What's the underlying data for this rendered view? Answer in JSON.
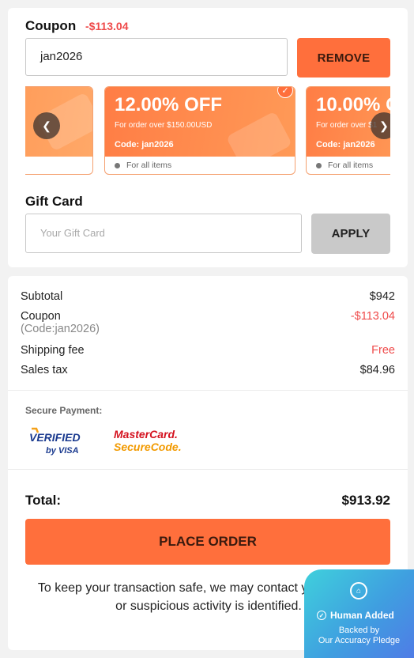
{
  "coupon": {
    "title": "Coupon",
    "discount": "-$113.04",
    "code_value": "jan2026",
    "remove_label": "REMOVE",
    "cards": [
      {
        "off": "",
        "condition": "",
        "code": "",
        "note": ""
      },
      {
        "off": "12.00% OFF",
        "condition": "For order over $150.00USD",
        "code": "Code: jan2026",
        "note": "For all items",
        "selected": true
      },
      {
        "off": "10.00% O",
        "condition": "For order over $1",
        "code": "Code: jan2026",
        "note": "For all items"
      }
    ],
    "prev_icon": "chevron-left-icon",
    "next_icon": "chevron-right-icon",
    "check_icon": "check-icon"
  },
  "gift_card": {
    "title": "Gift Card",
    "placeholder": "Your Gift Card",
    "apply_label": "APPLY"
  },
  "summary": {
    "subtotal_label": "Subtotal",
    "subtotal_value": "$942",
    "coupon_label": "Coupon",
    "coupon_code": "(Code:jan2026)",
    "coupon_value": "-$113.04",
    "shipping_label": "Shipping fee",
    "shipping_value": "Free",
    "tax_label": "Sales tax",
    "tax_value": "$84.96"
  },
  "payment": {
    "title": "Secure Payment:",
    "visa_line1": "VERIFIED",
    "visa_line2": "by VISA",
    "mc_line1": "MasterCard.",
    "mc_line2": "SecureCode."
  },
  "total": {
    "label": "Total:",
    "value": "$913.92"
  },
  "place_order_label": "PLACE ORDER",
  "notice": "To keep your transaction safe, we may contact you if unusual or suspicious activity is identified.",
  "human_badge": {
    "title": "Human Added",
    "line1": "Backed by",
    "line2": "Our Accuracy Pledge",
    "icon": "home-shield-icon"
  },
  "colors": {
    "accent": "#ff6f3c",
    "discount_red": "#ef4b4b",
    "apply_gray": "#c9c9c9"
  }
}
